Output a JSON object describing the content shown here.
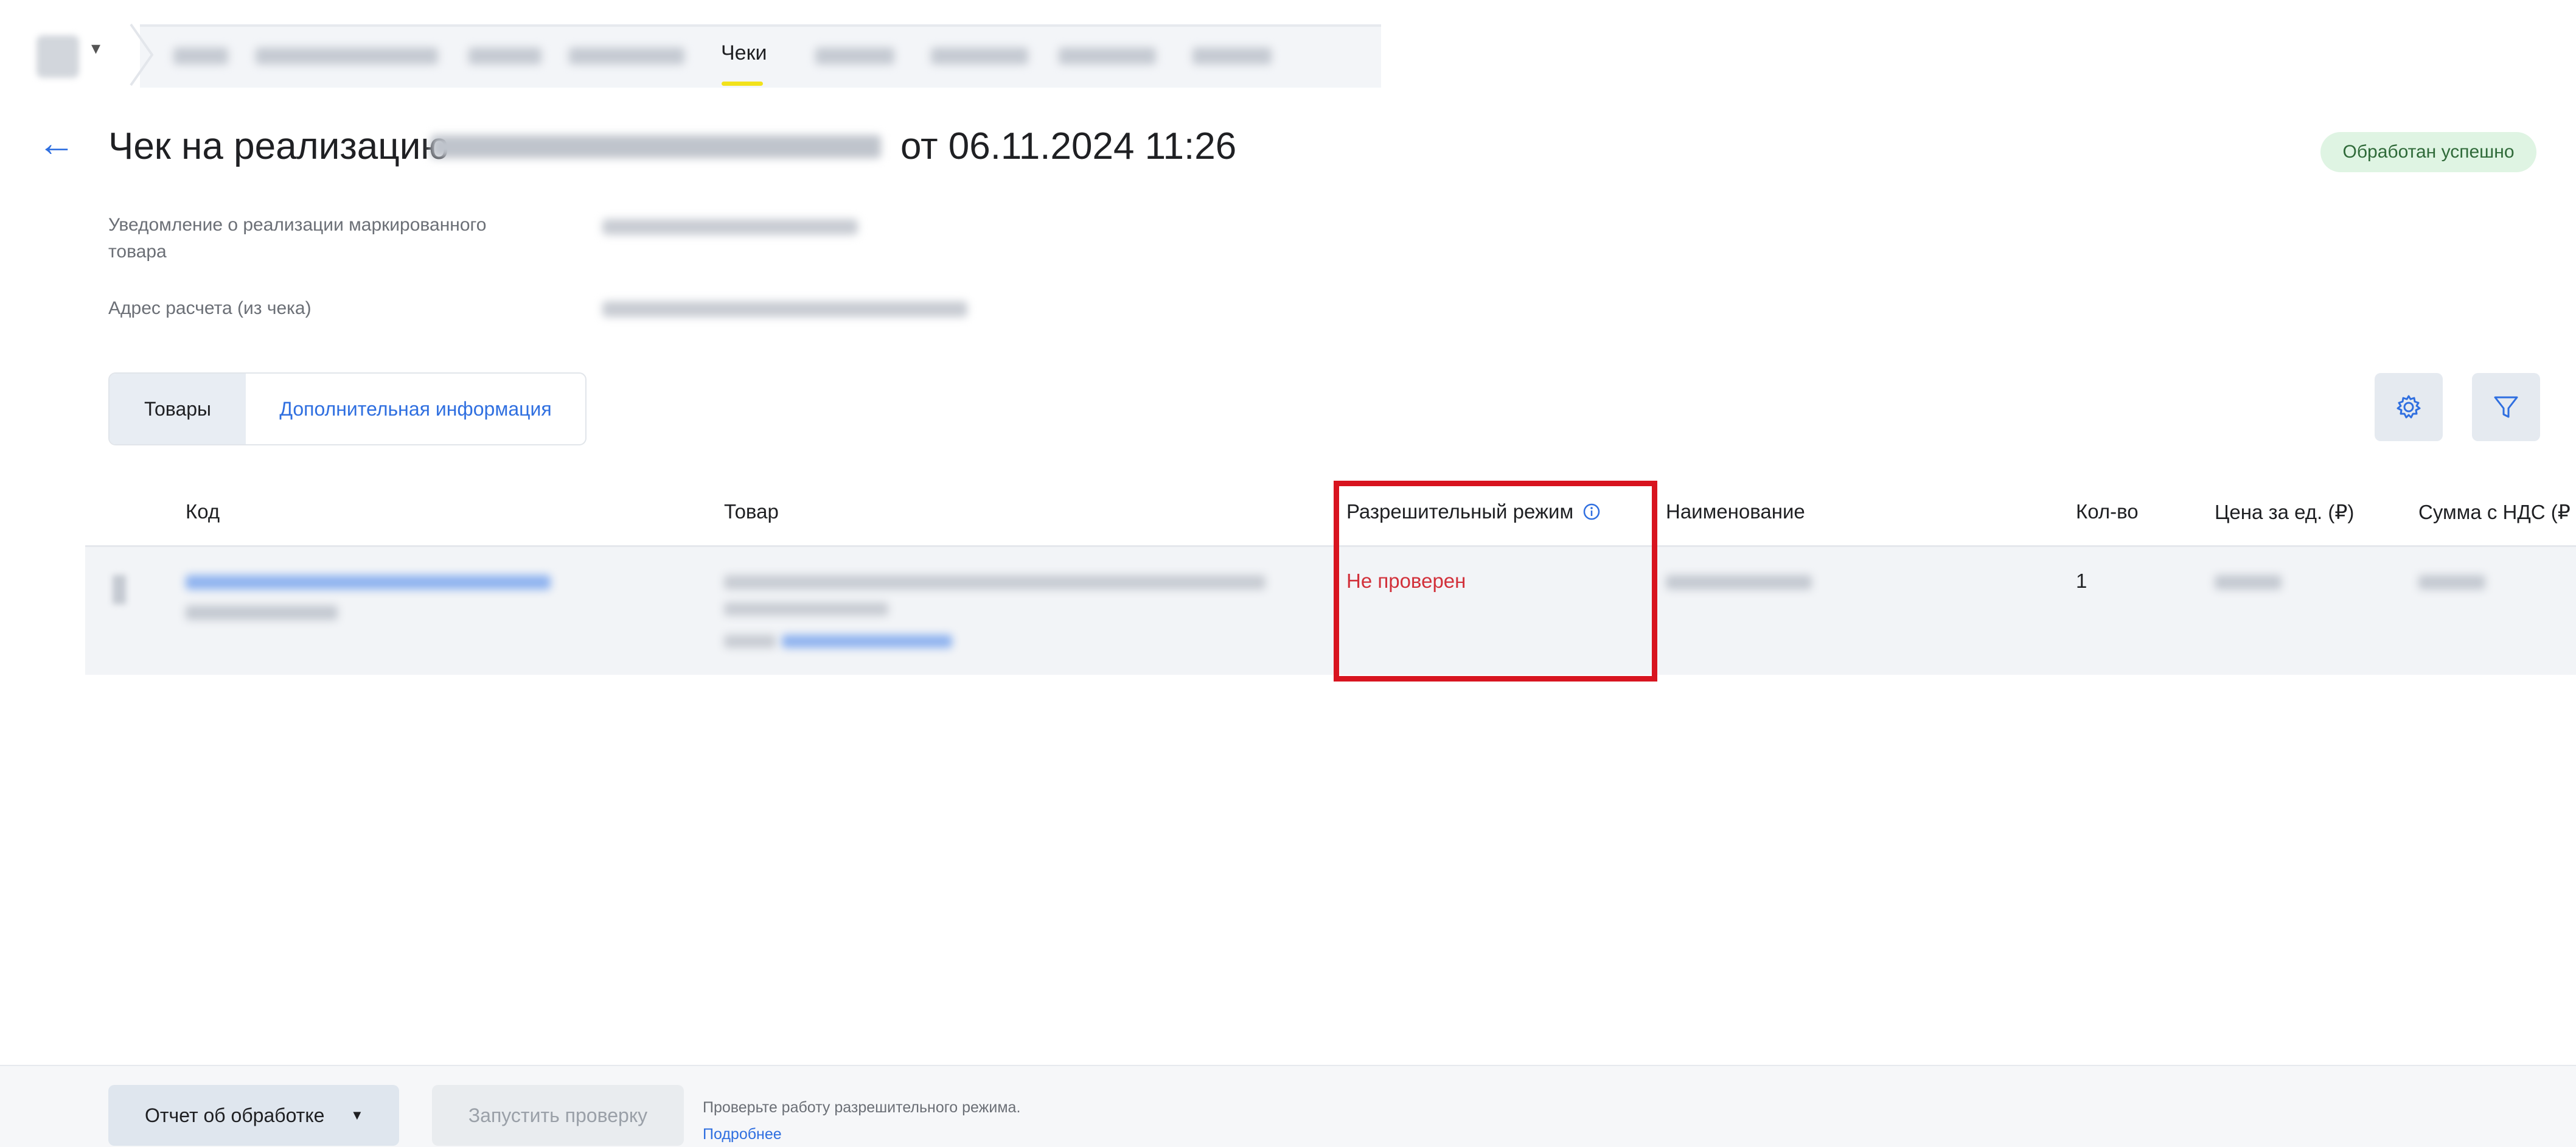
{
  "nav": {
    "active_tab": "Чеки",
    "accent_color": "#f2e21b"
  },
  "header": {
    "title_prefix": "Чек на реализацию",
    "title_suffix": "от 06.11.2024 11:26",
    "status": "Обработан успешно",
    "status_color": "#dff4e3"
  },
  "info": {
    "notice_label": "Уведомление о реализации маркированного товара",
    "address_label": "Адрес расчета (из чека)"
  },
  "tabs": {
    "products": "Товары",
    "extra": "Дополнительная информация"
  },
  "toolbar": {
    "settings_icon": "gear-icon",
    "filter_icon": "filter-icon"
  },
  "table": {
    "columns": {
      "code": "Код",
      "product": "Товар",
      "permit_mode": "Разрешительный режим",
      "name": "Наименование",
      "qty": "Кол-во",
      "unit_price": "Цена за ед. (₽)",
      "sum_vat": "Сумма с НДС (₽"
    },
    "rows": [
      {
        "permit_mode": "Не проверен",
        "qty": "1"
      }
    ]
  },
  "footer": {
    "report_button": "Отчет об обработке",
    "run_button": "Запустить проверку",
    "hint": "Проверьте работу разрешительного режима.",
    "hint_link": "Подробнее"
  }
}
